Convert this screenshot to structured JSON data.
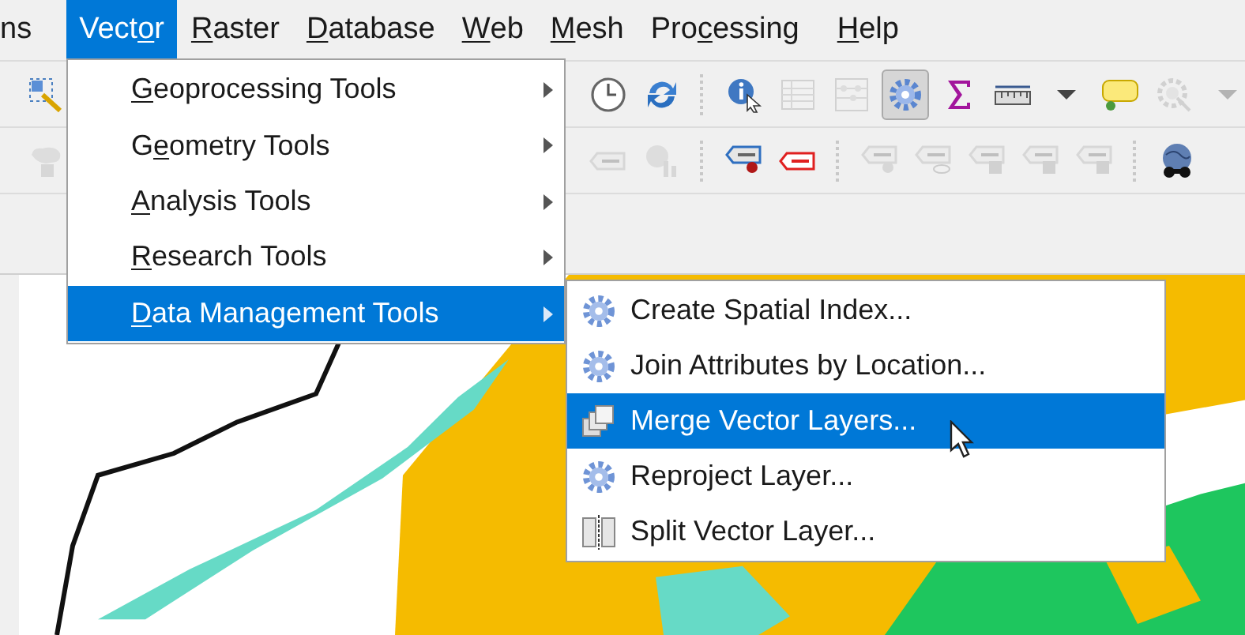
{
  "menubar": [
    {
      "parts": [
        {
          "text": "ns",
          "underline": false
        }
      ],
      "selected": false
    },
    {
      "parts": [
        {
          "text": "Vect",
          "underline": false
        },
        {
          "text": "o",
          "underline": true
        },
        {
          "text": "r",
          "underline": false
        }
      ],
      "selected": true
    },
    {
      "parts": [
        {
          "text": "R",
          "underline": true
        },
        {
          "text": "aster",
          "underline": false
        }
      ],
      "selected": false
    },
    {
      "parts": [
        {
          "text": "D",
          "underline": true
        },
        {
          "text": "atabase",
          "underline": false
        }
      ],
      "selected": false
    },
    {
      "parts": [
        {
          "text": "W",
          "underline": true
        },
        {
          "text": "eb",
          "underline": false
        }
      ],
      "selected": false
    },
    {
      "parts": [
        {
          "text": "M",
          "underline": true
        },
        {
          "text": "esh",
          "underline": false
        }
      ],
      "selected": false
    },
    {
      "parts": [
        {
          "text": "Pro",
          "underline": false
        },
        {
          "text": "c",
          "underline": true
        },
        {
          "text": "essing",
          "underline": false
        }
      ],
      "selected": false
    },
    {
      "parts": [
        {
          "text": "H",
          "underline": true
        },
        {
          "text": "elp",
          "underline": false
        }
      ],
      "selected": false
    }
  ],
  "toolbar_1": {
    "left": [
      {
        "kind": "select",
        "disabled": false,
        "pressed": false
      }
    ],
    "right": [
      {
        "kind": "clock",
        "disabled": false,
        "pressed": false
      },
      {
        "kind": "refresh",
        "disabled": false,
        "pressed": false
      },
      {
        "kind": "separator"
      },
      {
        "kind": "info",
        "disabled": false,
        "pressed": false
      },
      {
        "kind": "table",
        "disabled": true,
        "pressed": false
      },
      {
        "kind": "abacus",
        "disabled": true,
        "pressed": false
      },
      {
        "kind": "gear",
        "disabled": false,
        "pressed": true
      },
      {
        "kind": "sigma",
        "disabled": false,
        "pressed": false
      },
      {
        "kind": "ruler",
        "disabled": false,
        "pressed": false
      },
      {
        "kind": "caret",
        "disabled": false,
        "pressed": false
      },
      {
        "kind": "bubble",
        "disabled": false,
        "pressed": false
      },
      {
        "kind": "magnifier",
        "disabled": true,
        "pressed": false
      },
      {
        "kind": "caret",
        "disabled": true,
        "pressed": false
      }
    ]
  },
  "toolbar_2": {
    "left": [
      {
        "kind": "shape",
        "disabled": true,
        "pressed": false
      }
    ],
    "right": [
      {
        "kind": "tag",
        "disabled": true,
        "pressed": false
      },
      {
        "kind": "chart",
        "disabled": true,
        "pressed": false
      },
      {
        "kind": "separator"
      },
      {
        "kind": "tag-pin",
        "disabled": false,
        "pressed": false
      },
      {
        "kind": "tag-red",
        "disabled": false,
        "pressed": false
      },
      {
        "kind": "separator"
      },
      {
        "kind": "tag-pin",
        "disabled": true,
        "pressed": false
      },
      {
        "kind": "tag-eye",
        "disabled": true,
        "pressed": false
      },
      {
        "kind": "tag-arrow",
        "disabled": true,
        "pressed": false
      },
      {
        "kind": "tag-rotate",
        "disabled": true,
        "pressed": false
      },
      {
        "kind": "tag-edit",
        "disabled": true,
        "pressed": false
      },
      {
        "kind": "separator"
      },
      {
        "kind": "globe",
        "disabled": false,
        "pressed": false
      }
    ]
  },
  "menu": {
    "items": [
      {
        "parts": [
          {
            "text": "G",
            "underline": true
          },
          {
            "text": "eoprocessing Tools",
            "underline": false
          }
        ],
        "has_submenu": true,
        "selected": false
      },
      {
        "parts": [
          {
            "text": "G",
            "underline": false
          },
          {
            "text": "e",
            "underline": true
          },
          {
            "text": "ometry Tools",
            "underline": false
          }
        ],
        "has_submenu": true,
        "selected": false
      },
      {
        "parts": [
          {
            "text": "A",
            "underline": true
          },
          {
            "text": "nalysis Tools",
            "underline": false
          }
        ],
        "has_submenu": true,
        "selected": false
      },
      {
        "parts": [
          {
            "text": "R",
            "underline": true
          },
          {
            "text": "esearch Tools",
            "underline": false
          }
        ],
        "has_submenu": true,
        "selected": false
      },
      {
        "parts": [
          {
            "text": "D",
            "underline": true
          },
          {
            "text": "ata Management Tools",
            "underline": false
          }
        ],
        "has_submenu": true,
        "selected": true
      }
    ]
  },
  "submenu": {
    "items": [
      {
        "label": "Create Spatial Index...",
        "kind": "tool",
        "selected": false
      },
      {
        "label": "Join Attributes by Location...",
        "kind": "tool",
        "selected": false
      },
      {
        "label": "Merge Vector Layers...",
        "kind": "merge",
        "selected": true
      },
      {
        "label": "Reproject Layer...",
        "kind": "tool",
        "selected": false
      },
      {
        "label": "Split Vector Layer...",
        "kind": "split",
        "selected": false
      }
    ]
  }
}
